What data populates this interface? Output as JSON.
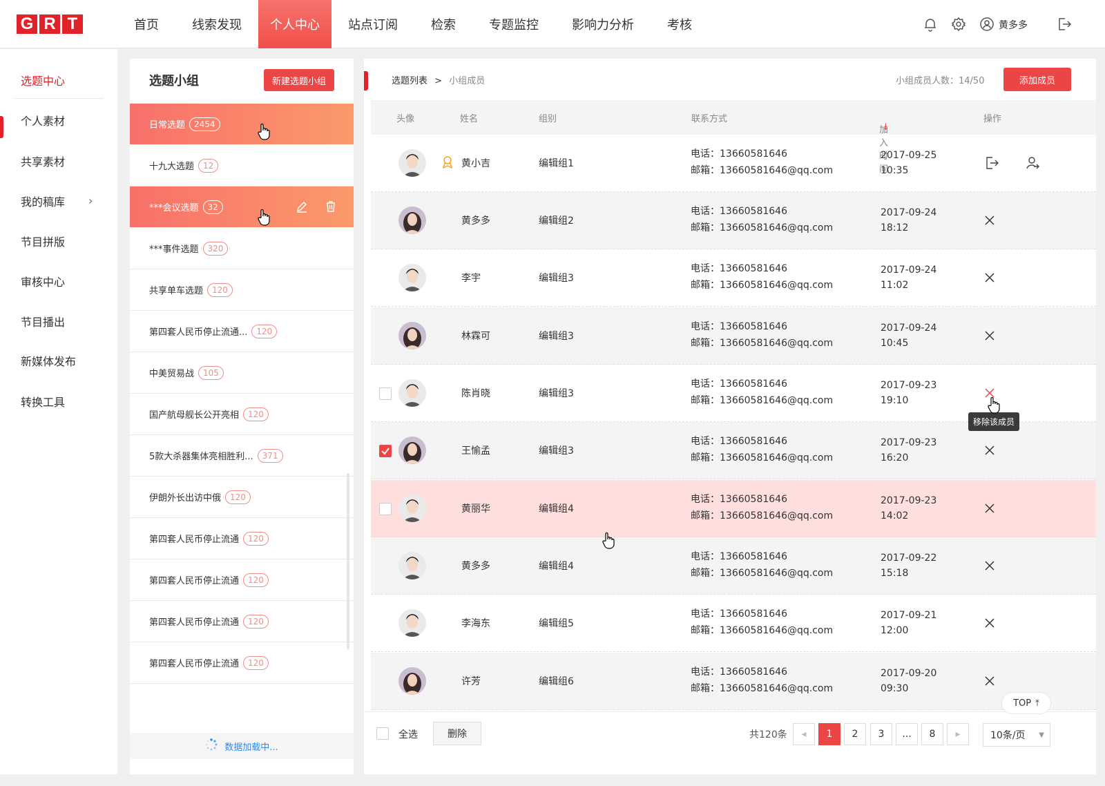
{
  "header": {
    "logo": [
      "G",
      "R",
      "T"
    ],
    "nav": [
      "首页",
      "线索发现",
      "个人中心",
      "站点订阅",
      "检索",
      "专题监控",
      "影响力分析",
      "考核"
    ],
    "active_nav": "个人中心",
    "username": "黄多多",
    "accent": "#e0232a"
  },
  "sidebar": {
    "items": [
      "选题中心",
      "个人素材",
      "共享素材",
      "我的稿库",
      "节目拼版",
      "审核中心",
      "节目播出",
      "新媒体发布",
      "转换工具"
    ],
    "active": "选题中心"
  },
  "groups": {
    "title": "选题小组",
    "new_button": "新建选题小组",
    "items": [
      {
        "name": "日常选题",
        "count": "2454"
      },
      {
        "name": "十九大选题",
        "count": "12"
      },
      {
        "name": "***会议选题",
        "count": "32"
      },
      {
        "name": "***事件选题",
        "count": "320"
      },
      {
        "name": "共享单车选题",
        "count": "120"
      },
      {
        "name": "第四套人民币停止流通...",
        "count": "120"
      },
      {
        "name": "中美贸易战",
        "count": "105"
      },
      {
        "name": "国产航母舰长公开亮相",
        "count": "120"
      },
      {
        "name": "5款大杀器集体亮相胜利...",
        "count": "371"
      },
      {
        "name": "伊朗外长出访中俄",
        "count": "120"
      },
      {
        "name": "第四套人民币停止流通",
        "count": "120"
      },
      {
        "name": "第四套人民币停止流通",
        "count": "120"
      },
      {
        "name": "第四套人民币停止流通",
        "count": "120"
      },
      {
        "name": "第四套人民币停止流通",
        "count": "120"
      }
    ],
    "loading_text": "数据加载中..."
  },
  "main": {
    "breadcrumb": {
      "parent": "选题列表",
      "sep": ">",
      "current": "小组成员"
    },
    "member_count": "小组成员人数：14/50",
    "add_button": "添加成员",
    "columns": {
      "avatar": "头像",
      "name": "姓名",
      "group": "组别",
      "contact": "联系方式",
      "join_time": "加入时间",
      "op": "操作"
    },
    "rows": [
      {
        "name": "黄小吉",
        "group": "编辑组1",
        "phone": "电话：13660581646",
        "email": "邮箱：13660581646@qq.com",
        "date": "2017-09-25",
        "time": "10:35",
        "leader": true
      },
      {
        "name": "黄多多",
        "group": "编辑组2",
        "phone": "电话：13660581646",
        "email": "邮箱：13660581646@qq.com",
        "date": "2017-09-24",
        "time": "18:12"
      },
      {
        "name": "李宇",
        "group": "编辑组3",
        "phone": "电话：13660581646",
        "email": "邮箱：13660581646@qq.com",
        "date": "2017-09-24",
        "time": "11:02"
      },
      {
        "name": "林霖可",
        "group": "编辑组3",
        "phone": "电话：13660581646",
        "email": "邮箱：13660581646@qq.com",
        "date": "2017-09-24",
        "time": "10:45"
      },
      {
        "name": "陈肖晓",
        "group": "编辑组3",
        "phone": "电话：13660581646",
        "email": "邮箱：13660581646@qq.com",
        "date": "2017-09-23",
        "time": "19:10",
        "checkbox": "off"
      },
      {
        "name": "王愉孟",
        "group": "编辑组3",
        "phone": "电话：13660581646",
        "email": "邮箱：13660581646@qq.com",
        "date": "2017-09-23",
        "time": "16:20",
        "checkbox": "on"
      },
      {
        "name": "黄丽华",
        "group": "编辑组4",
        "phone": "电话：13660581646",
        "email": "邮箱：13660581646@qq.com",
        "date": "2017-09-23",
        "time": "14:02",
        "checkbox": "off"
      },
      {
        "name": "黄多多",
        "group": "编辑组4",
        "phone": "电话：13660581646",
        "email": "邮箱：13660581646@qq.com",
        "date": "2017-09-22",
        "time": "15:18"
      },
      {
        "name": "李海东",
        "group": "编辑组5",
        "phone": "电话：13660581646",
        "email": "邮箱：13660581646@qq.com",
        "date": "2017-09-21",
        "time": "12:00"
      },
      {
        "name": "许芳",
        "group": "编辑组6",
        "phone": "电话：13660581646",
        "email": "邮箱：13660581646@qq.com",
        "date": "2017-09-20",
        "time": "09:30"
      }
    ],
    "tooltip": "移除该成员",
    "footer": {
      "select_all": "全选",
      "delete": "删除",
      "total": "共120条",
      "pages": [
        "1",
        "2",
        "3",
        "...",
        "8"
      ],
      "current_page": "1",
      "page_size": "10条/页"
    },
    "top_button": "TOP"
  }
}
